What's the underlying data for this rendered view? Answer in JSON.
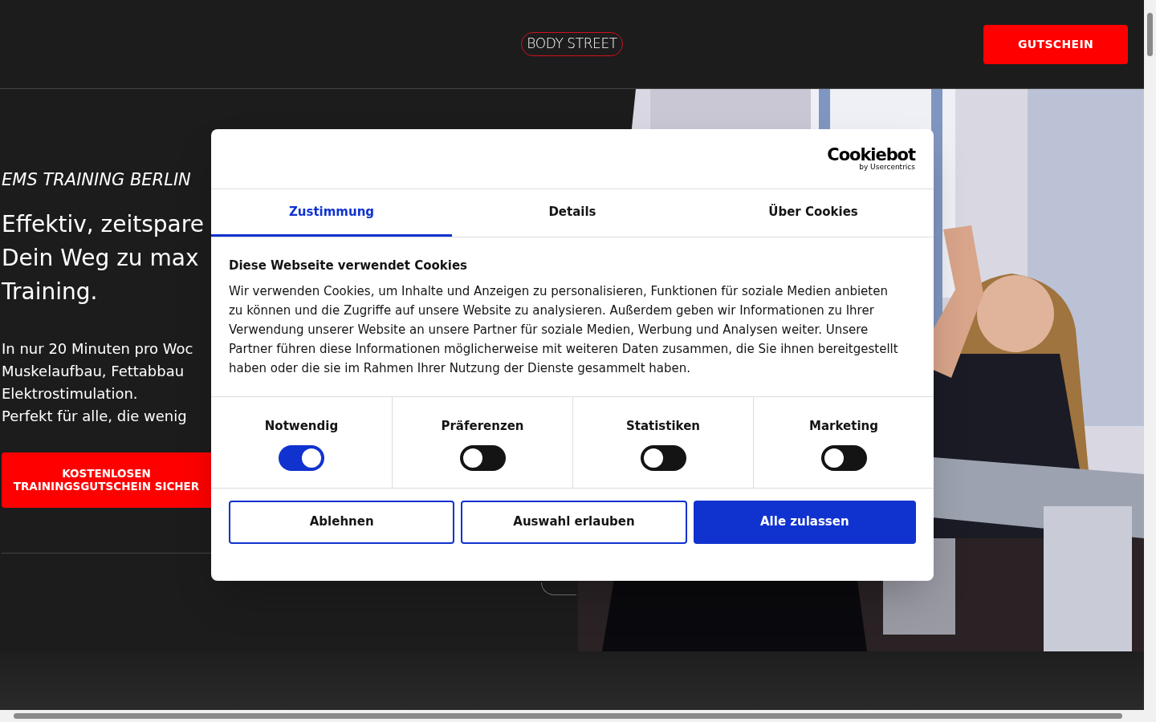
{
  "header": {
    "logo": "BODY STREET",
    "voucher_button": "GUTSCHEIN"
  },
  "hero": {
    "eyebrow": "EMS TRAINING BERLIN",
    "headline_lines": [
      "Effektiv, zeitspare",
      "Dein Weg zu max",
      "Training."
    ],
    "body_lines": [
      "In nur 20 Minuten pro Woc",
      "Muskelaufbau, Fettabbau",
      "Elektrostimulation.",
      "Perfekt für alle, die wenig"
    ],
    "cta_lines": [
      "KOSTENLOSEN",
      "TRAININGSGUTSCHEIN SICHER"
    ]
  },
  "cookie_dialog": {
    "logo": "Cookiebot",
    "logo_sub": "by Usercentrics",
    "tabs": [
      {
        "label": "Zustimmung",
        "selected": true
      },
      {
        "label": "Details",
        "selected": false
      },
      {
        "label": "Über Cookies",
        "selected": false
      }
    ],
    "title": "Diese Webseite verwendet Cookies",
    "text": "Wir verwenden Cookies, um Inhalte und Anzeigen zu personalisieren, Funktionen für soziale Medien anbieten zu können und die Zugriffe auf unsere Website zu analysieren. Außerdem geben wir Informationen zu Ihrer Verwendung unserer Website an unsere Partner für soziale Medien, Werbung und Analysen weiter. Unsere Partner führen diese Informationen möglicherweise mit weiteren Daten zusammen, die Sie ihnen bereitgestellt haben oder die sie im Rahmen Ihrer Nutzung der Dienste gesammelt haben.",
    "categories": [
      {
        "label": "Notwendig",
        "on": true
      },
      {
        "label": "Präferenzen",
        "on": false
      },
      {
        "label": "Statistiken",
        "on": false
      },
      {
        "label": "Marketing",
        "on": false
      }
    ],
    "buttons": [
      {
        "label": "Ablehnen",
        "kind": "outline"
      },
      {
        "label": "Auswahl erlauben",
        "kind": "outline"
      },
      {
        "label": "Alle zulassen",
        "kind": "primary"
      }
    ]
  }
}
